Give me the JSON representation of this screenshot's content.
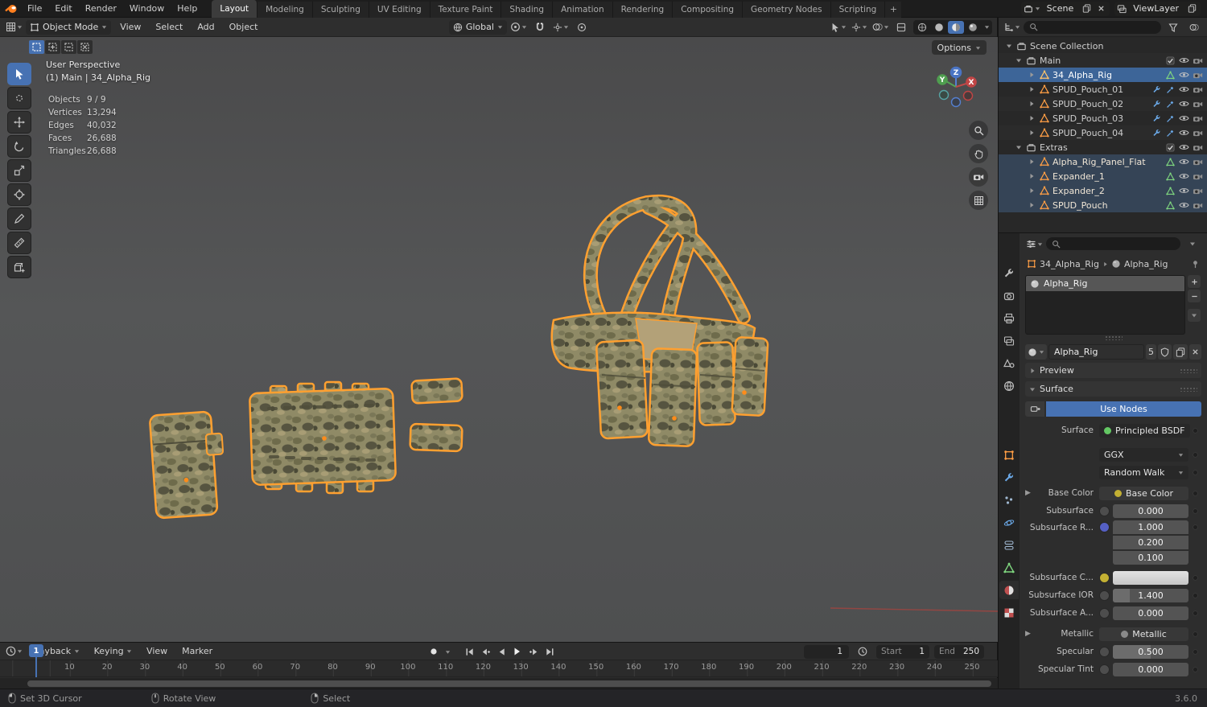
{
  "colors": {
    "accent_blue": "#4772b3",
    "selection_outline_orange": "#ffa030",
    "mesh_icon_orange": "#ff9e45",
    "modifier_icon_blue": "#6ba9e8",
    "data_icon_green": "#6fcf6f",
    "viewport_background": "#505051",
    "panel_background": "#2d2d2d"
  },
  "icons": {
    "search-icon": "magnifier",
    "filter-icon": "funnel",
    "eye-icon": "visibility eye",
    "camera-icon": "render camera",
    "mesh-icon": "orange triangle",
    "collection-icon": "box",
    "wrench-icon": "modifier wrench",
    "sphere-icon": "material sphere",
    "magnet-icon": "snap magnet",
    "record-icon": "auto-key record dot",
    "pin-icon": "pin",
    "shield-icon": "fake user shield"
  },
  "topbar": {
    "app_menus": [
      "File",
      "Edit",
      "Render",
      "Window",
      "Help"
    ],
    "workspaces": [
      "Layout",
      "Modeling",
      "Sculpting",
      "UV Editing",
      "Texture Paint",
      "Shading",
      "Animation",
      "Rendering",
      "Compositing",
      "Geometry Nodes",
      "Scripting"
    ],
    "active_workspace": "Layout",
    "new_workspace_button": "+",
    "scene_name": "Scene",
    "viewlayer_name": "ViewLayer"
  },
  "viewport_header": {
    "mode": "Object Mode",
    "menus": [
      "View",
      "Select",
      "Add",
      "Object"
    ],
    "orientation": "Global",
    "options_button": "Options"
  },
  "viewport": {
    "view_label": "User Perspective",
    "context_label": "(1) Main | 34_Alpha_Rig",
    "stats": [
      {
        "label": "Objects",
        "value": "9 / 9"
      },
      {
        "label": "Vertices",
        "value": "13,294"
      },
      {
        "label": "Edges",
        "value": "40,032"
      },
      {
        "label": "Faces",
        "value": "26,688"
      },
      {
        "label": "Triangles",
        "value": "26,688"
      }
    ],
    "gizmo": {
      "x": "X",
      "y": "Y",
      "z": "Z"
    }
  },
  "outliner": {
    "root_label": "Scene Collection",
    "collections": [
      {
        "name": "Main",
        "items": [
          {
            "name": "34_Alpha_Rig",
            "state": "active",
            "badges": [
              "mesh-data"
            ]
          },
          {
            "name": "SPUD_Pouch_01",
            "state": "normal",
            "badges": [
              "modifier",
              "tool"
            ]
          },
          {
            "name": "SPUD_Pouch_02",
            "state": "normal",
            "badges": [
              "modifier",
              "tool"
            ]
          },
          {
            "name": "SPUD_Pouch_03",
            "state": "normal",
            "badges": [
              "modifier",
              "tool"
            ]
          },
          {
            "name": "SPUD_Pouch_04",
            "state": "normal",
            "badges": [
              "modifier",
              "tool"
            ]
          }
        ]
      },
      {
        "name": "Extras",
        "items": [
          {
            "name": "Alpha_Rig_Panel_Flat",
            "state": "selected",
            "badges": [
              "mesh-data"
            ]
          },
          {
            "name": "Expander_1",
            "state": "selected",
            "badges": [
              "mesh-data"
            ]
          },
          {
            "name": "Expander_2",
            "state": "selected",
            "badges": [
              "mesh-data"
            ]
          },
          {
            "name": "SPUD_Pouch",
            "state": "selected",
            "badges": [
              "mesh-data"
            ]
          }
        ]
      }
    ]
  },
  "properties": {
    "breadcrumb": {
      "object": "34_Alpha_Rig",
      "material": "Alpha_Rig"
    },
    "slot_name": "Alpha_Rig",
    "material_name": "Alpha_Rig",
    "material_users": "5",
    "panels": {
      "preview": "Preview",
      "surface": "Surface"
    },
    "use_nodes_button": "Use Nodes",
    "fields": {
      "surface_label": "Surface",
      "surface_value": "Principled BSDF",
      "distribution_value": "GGX",
      "subsurface_method_value": "Random Walk",
      "base_color_label": "Base Color",
      "base_color_value": "Base Color",
      "subsurface_label": "Subsurface",
      "subsurface_value": "0.000",
      "subsurface_radius_label": "Subsurface R...",
      "subsurface_radius_values": [
        "1.000",
        "0.200",
        "0.100"
      ],
      "subsurface_color_label": "Subsurface C...",
      "subsurface_ior_label": "Subsurface IOR",
      "subsurface_ior_value": "1.400",
      "subsurface_aniso_label": "Subsurface A...",
      "subsurface_aniso_value": "0.000",
      "metallic_label": "Metallic",
      "metallic_value": "Metallic",
      "specular_label": "Specular",
      "specular_value": "0.500",
      "specular_tint_label": "Specular Tint",
      "specular_tint_value": "0.000"
    }
  },
  "timeline": {
    "menus": [
      "Playback",
      "Keying",
      "View",
      "Marker"
    ],
    "current_frame": "1",
    "start_label": "Start",
    "start_value": "1",
    "end_label": "End",
    "end_value": "250",
    "ticks": [
      "10",
      "20",
      "30",
      "40",
      "50",
      "60",
      "70",
      "80",
      "90",
      "100",
      "110",
      "120",
      "130",
      "140",
      "150",
      "160",
      "170",
      "180",
      "190",
      "200",
      "210",
      "220",
      "230",
      "240",
      "250"
    ]
  },
  "statusbar": {
    "hint_left": "Set 3D Cursor",
    "hint_middle": "Rotate View",
    "hint_right": "Select",
    "version": "3.6.0"
  }
}
